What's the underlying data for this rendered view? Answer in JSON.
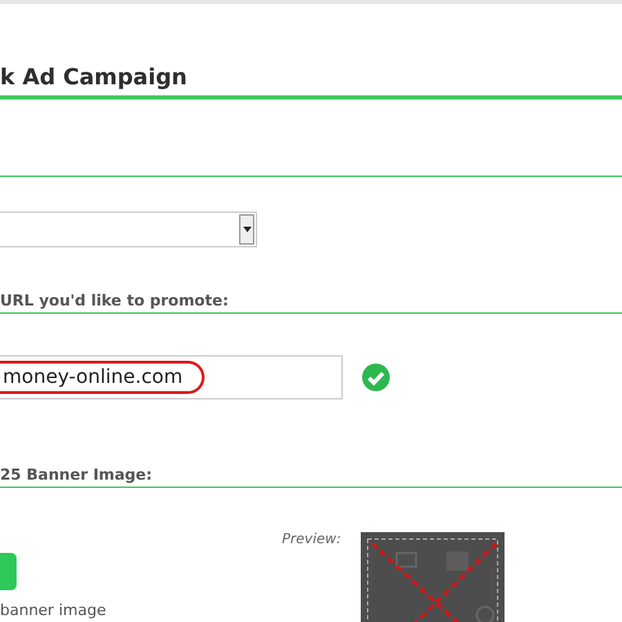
{
  "heading": "k Ad Campaign",
  "url_section": {
    "label": "URL you'd like to promote:",
    "value": "money-online.com",
    "valid": true,
    "highlighted": true
  },
  "banner_section": {
    "label": "25 Banner Image:",
    "preview_label": "Preview:",
    "hint": "banner image",
    "crossed_out": true
  }
}
